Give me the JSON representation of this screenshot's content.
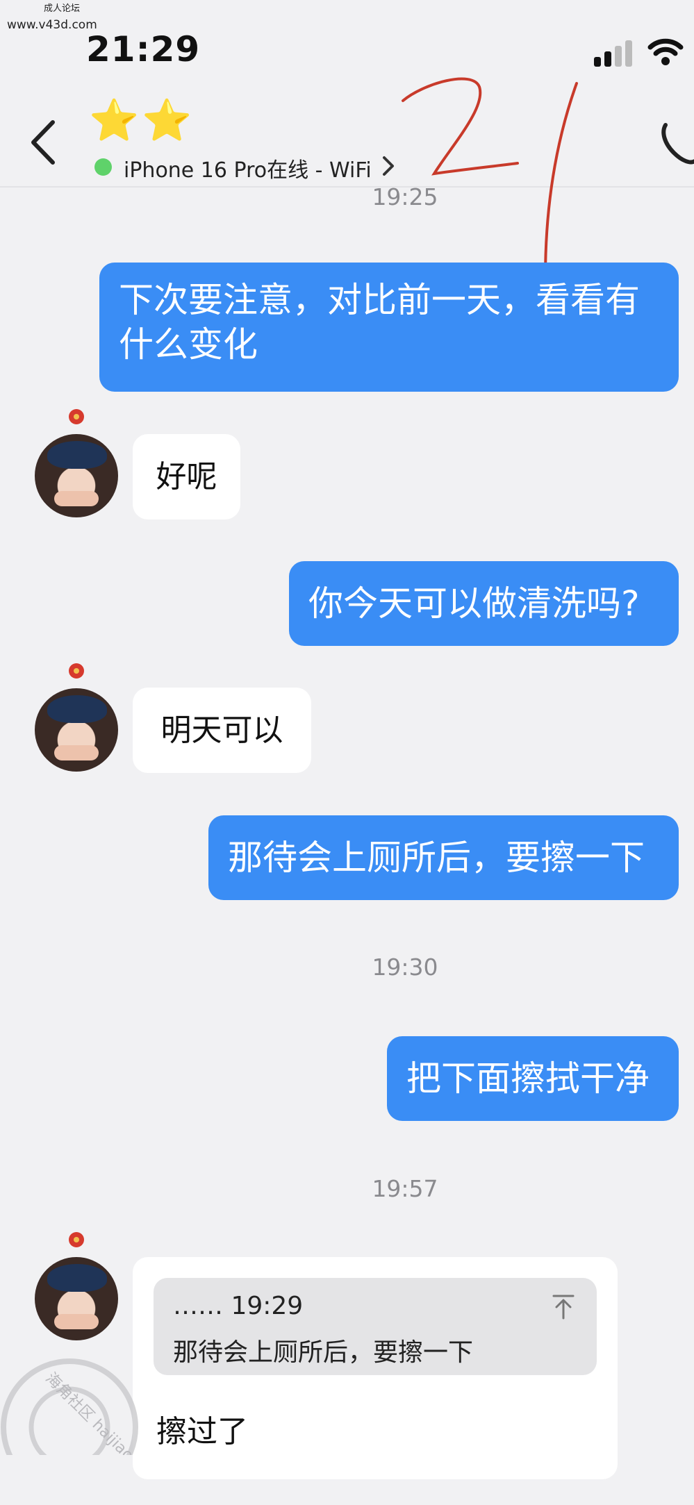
{
  "status_bar": {
    "site_tag": "成人论坛",
    "site_url": "www.v43d.com",
    "time": "21:29"
  },
  "header": {
    "contact_name": "⭐⭐",
    "device_status": "iPhone 16 Pro在线 - WiFi"
  },
  "annotation": {
    "number": "21"
  },
  "messages": [
    {
      "type": "timestamp",
      "text": "19:25"
    },
    {
      "type": "sent",
      "text_line1": "下次要注意，对比前一天，看看有",
      "text_line2": "什么变化"
    },
    {
      "type": "received",
      "text": "好呢"
    },
    {
      "type": "sent",
      "text": "你今天可以做清洗吗?"
    },
    {
      "type": "received",
      "text": "明天可以"
    },
    {
      "type": "sent",
      "text": "那待会上厕所后，要擦一下"
    },
    {
      "type": "timestamp",
      "text": "19:30"
    },
    {
      "type": "sent",
      "text": "把下面擦拭干净"
    },
    {
      "type": "timestamp",
      "text": "19:57"
    },
    {
      "type": "received_quote",
      "quote_meta": "…… 19:29",
      "quote_text": "那待会上厕所后，要擦一下",
      "text": "擦过了"
    }
  ],
  "watermark": {
    "text": "海角社区 haijiao.com"
  },
  "colors": {
    "sent_bubble": "#3a8df5",
    "received_bubble": "#ffffff",
    "background": "#f1f1f3",
    "online_dot": "#5fd26a",
    "annotation": "#c83a2a"
  }
}
